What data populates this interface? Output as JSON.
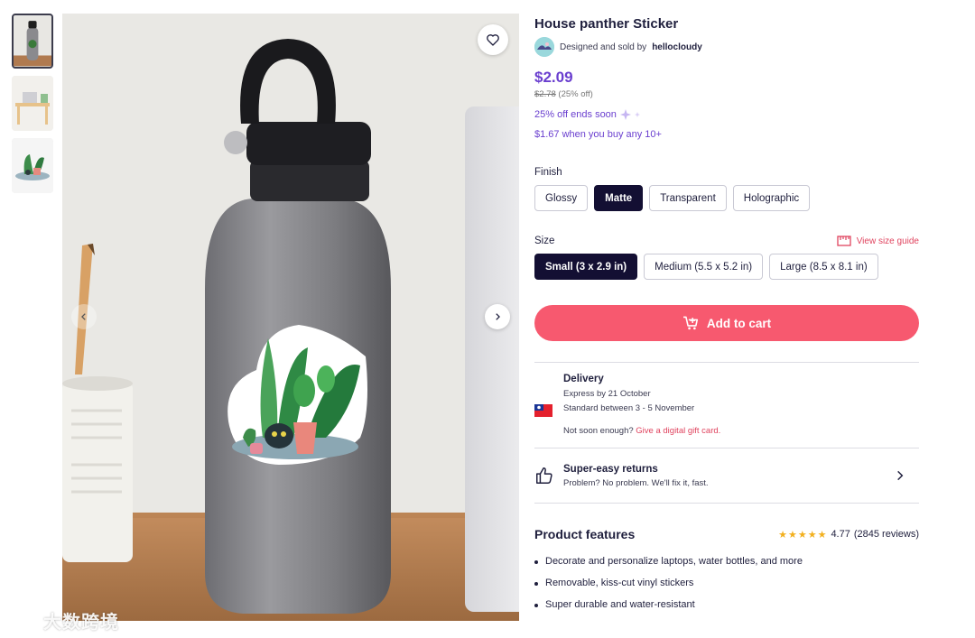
{
  "product": {
    "title": "House panther Sticker",
    "designer_prefix": "Designed and sold by",
    "designer_name": "hellocloudy",
    "price": "$2.09",
    "old_price": "$2.78",
    "discount": "(25% off)",
    "promo": "25% off ends soon",
    "bulk_offer": "$1.67 when you buy any 10+"
  },
  "finish": {
    "label": "Finish",
    "options": [
      "Glossy",
      "Matte",
      "Transparent",
      "Holographic"
    ],
    "selected": "Matte"
  },
  "size": {
    "label": "Size",
    "guide_label": "View size guide",
    "options": [
      "Small (3 x 2.9 in)",
      "Medium (5.5 x 5.2 in)",
      "Large (8.5 x 8.1 in)"
    ],
    "selected": "Small (3 x 2.9 in)"
  },
  "cart": {
    "label": "Add to cart"
  },
  "delivery": {
    "title": "Delivery",
    "express": "Express by 21 October",
    "standard": "Standard between 3 - 5 November",
    "note_prefix": "Not soon enough?",
    "note_link": "Give a digital gift card."
  },
  "returns": {
    "title": "Super-easy returns",
    "subtitle": "Problem? No problem. We'll fix it, fast."
  },
  "features": {
    "title": "Product features",
    "rating_value": "4.77",
    "rating_count": "(2845 reviews)",
    "stars": "★★★★★",
    "items": [
      "Decorate and personalize laptops, water bottles, and more",
      "Removable, kiss-cut vinyl stickers",
      "Super durable and water-resistant"
    ]
  },
  "watermark": "大数跨境",
  "colors": {
    "accent_purple": "#6a3fcf",
    "cart_pink": "#f7596f",
    "link_red": "#e0445f",
    "selected_dark": "#130f33"
  }
}
